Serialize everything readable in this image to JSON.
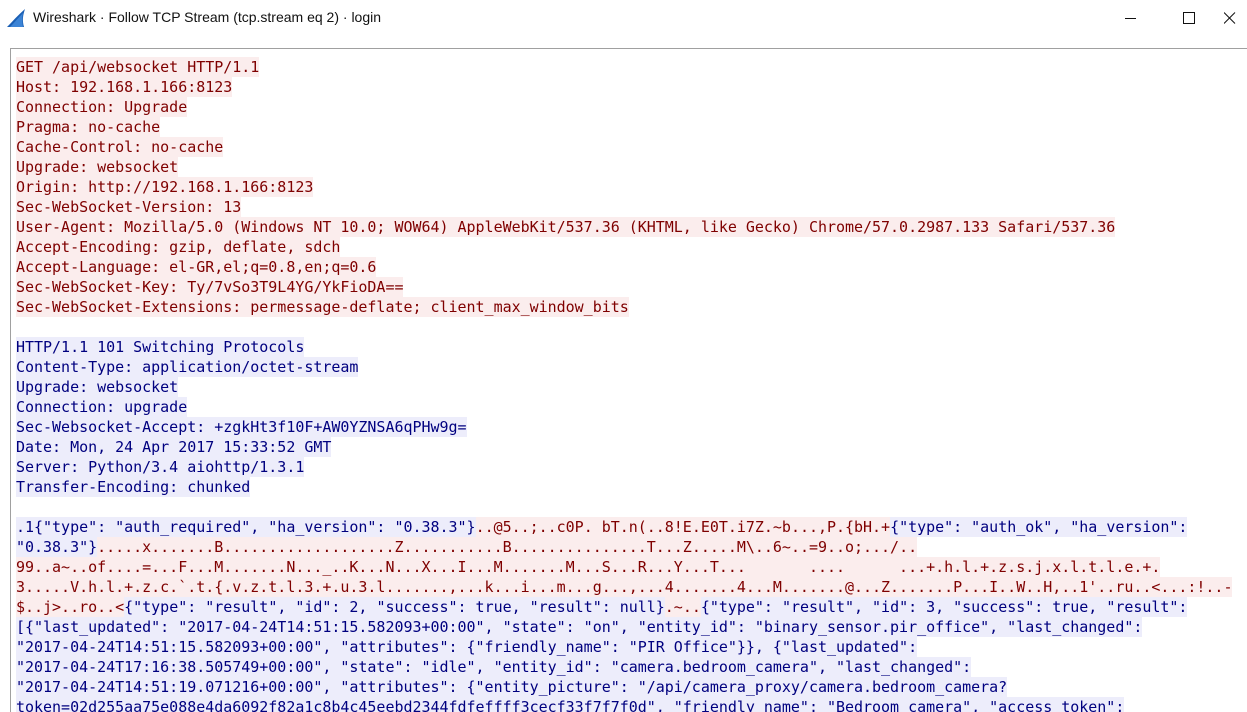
{
  "window": {
    "title": "Wireshark · Follow TCP Stream (tcp.stream eq 2) · login",
    "icon": "wireshark-fin-icon",
    "controls": [
      "minimize-icon",
      "maximize-icon",
      "close-icon"
    ]
  },
  "colors": {
    "client_fg": "#7f0000",
    "client_bg": "#fbeded",
    "server_fg": "#00007f",
    "server_bg": "#ededfb",
    "app_icon": "#1a5fb4"
  },
  "stream": {
    "client_request": [
      "GET /api/websocket HTTP/1.1",
      "Host: 192.168.1.166:8123",
      "Connection: Upgrade",
      "Pragma: no-cache",
      "Cache-Control: no-cache",
      "Upgrade: websocket",
      "Origin: http://192.168.1.166:8123",
      "Sec-WebSocket-Version: 13",
      "User-Agent: Mozilla/5.0 (Windows NT 10.0; WOW64) AppleWebKit/537.36 (KHTML, like Gecko) Chrome/57.0.2987.133 Safari/537.36",
      "Accept-Encoding: gzip, deflate, sdch",
      "Accept-Language: el-GR,el;q=0.8,en;q=0.6",
      "Sec-WebSocket-Key: Ty/7vSo3T9L4YG/YkFioDA==",
      "Sec-WebSocket-Extensions: permessage-deflate; client_max_window_bits"
    ],
    "server_response": [
      "HTTP/1.1 101 Switching Protocols",
      "Content-Type: application/octet-stream",
      "Upgrade: websocket",
      "Connection: upgrade",
      "Sec-Websocket-Accept: +zgkHt3f10F+AW0YZNSA6qPHw9g=",
      "Date: Mon, 24 Apr 2017 15:33:52 GMT",
      "Server: Python/3.4 aiohttp/1.3.1",
      "Transfer-Encoding: chunked"
    ],
    "payload": {
      "line1_server": ".1{\"type\": \"auth_required\", \"ha_version\": \"0.38.3\"}",
      "line1_client": "..@5..;..c0P. bT.n(..8!E.E0T.i7Z.~b...,P.{bH.+",
      "line1_server_b": "{\"type\": \"auth_ok\", \"ha_version\":",
      "line2_server": "\"0.38.3\"}",
      "line2_client": ".....x.......B...................Z...........B...............T...Z.....M\\..6~..=9..o;.../..",
      "line3_client": "99..a~..of....=...F...M.......N..._..K...N...X...I...M.......M...S...R...Y...T...       ....      ...+.h.l.+.z.s.j.x.l.t.l.e.+.",
      "line4_client": "3.....V.h.l.+.z.c.`.t.{.v.z.t.l.3.+.u.3.l.......,...k...i...m...g...,...4.......4...M.......@...Z.......P...I..W..H,..1'..ru..<...:!..-",
      "line5_client": "$..j>..ro..<",
      "line5_server": "{\"type\": \"result\", \"id\": 2, \"success\": true, \"result\": null}",
      "line5_client_b": ".~..",
      "line5_server_b": "{\"type\": \"result\", \"id\": 3, \"success\": true, \"result\":",
      "line6_server": "[{\"last_updated\": \"2017-04-24T14:51:15.582093+00:00\", \"state\": \"on\", \"entity_id\": \"binary_sensor.pir_office\", \"last_changed\":",
      "line7_server": "\"2017-04-24T14:51:15.582093+00:00\", \"attributes\": {\"friendly_name\": \"PIR Office\"}}, {\"last_updated\":",
      "line8_server": "\"2017-04-24T17:16:38.505749+00:00\", \"state\": \"idle\", \"entity_id\": \"camera.bedroom_camera\", \"last_changed\":",
      "line9_server": "\"2017-04-24T14:51:19.071216+00:00\", \"attributes\": {\"entity_picture\": \"/api/camera_proxy/camera.bedroom_camera?",
      "line10_server": "token=02d255aa75e088e4da6092f82a1c8b4c45eebd2344fdfeffff3cecf33f7f7f0d\", \"friendly_name\": \"Bedroom camera\", \"access_token\":"
    }
  }
}
